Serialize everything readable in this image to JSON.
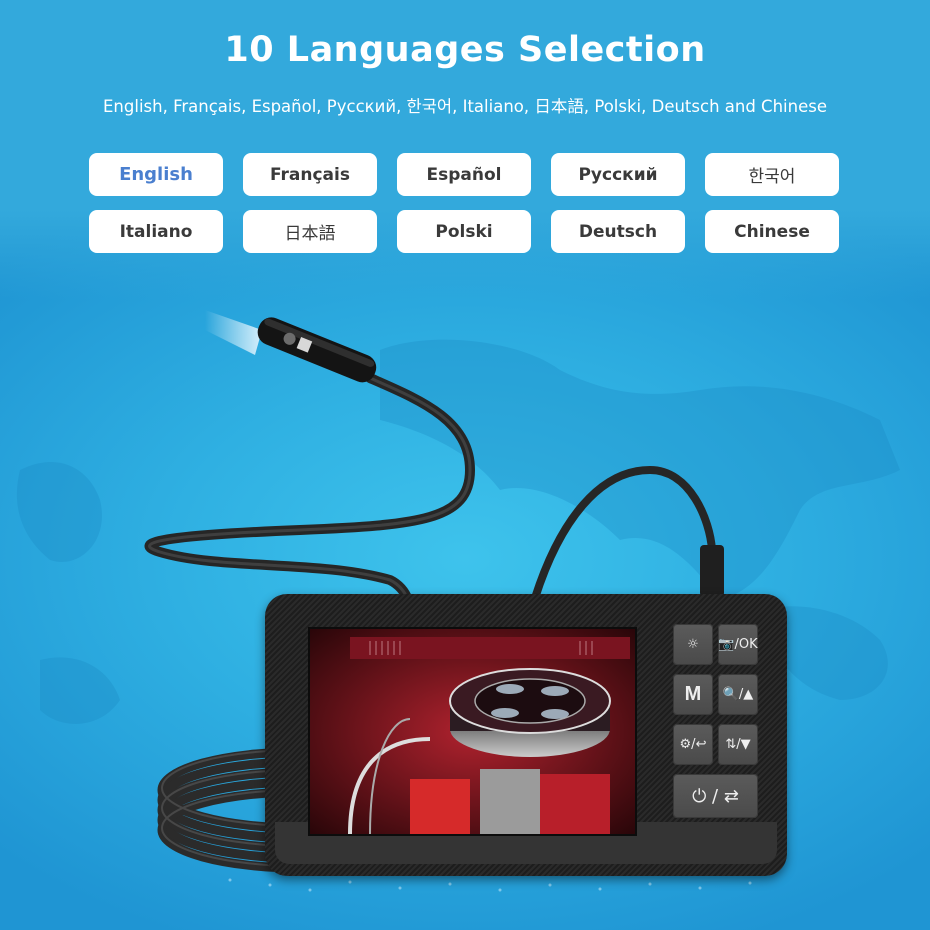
{
  "header": {
    "title": "10 Languages Selection",
    "subtitle": "English, Français, Español, Русский, 한국어, Italiano, 日本語, Polski, Deutsch and Chinese"
  },
  "languages": [
    {
      "label": "English",
      "selected": true
    },
    {
      "label": "Français",
      "selected": false
    },
    {
      "label": "Español",
      "selected": false
    },
    {
      "label": "Русский",
      "selected": false
    },
    {
      "label": "한국어",
      "selected": false
    },
    {
      "label": "Italiano",
      "selected": false
    },
    {
      "label": "日本語",
      "selected": false
    },
    {
      "label": "Polski",
      "selected": false
    },
    {
      "label": "Deutsch",
      "selected": false
    },
    {
      "label": "Chinese",
      "selected": false
    }
  ],
  "device": {
    "screen_content": "engine bay image",
    "keys": [
      {
        "name": "light",
        "label": "☼"
      },
      {
        "name": "capture-ok",
        "label": "📷/OK"
      },
      {
        "name": "mode",
        "label": "M"
      },
      {
        "name": "zoom-up",
        "label": "🔍/▲"
      },
      {
        "name": "settings-back",
        "label": "⚙/↩"
      },
      {
        "name": "flip-down",
        "label": "⇅/▼"
      },
      {
        "name": "power-switch",
        "label": "⏻ / ⇄"
      }
    ]
  },
  "colors": {
    "background": "#33a9dc",
    "selected_language": "#4a7fcf",
    "button_text": "#3a3a3a"
  }
}
